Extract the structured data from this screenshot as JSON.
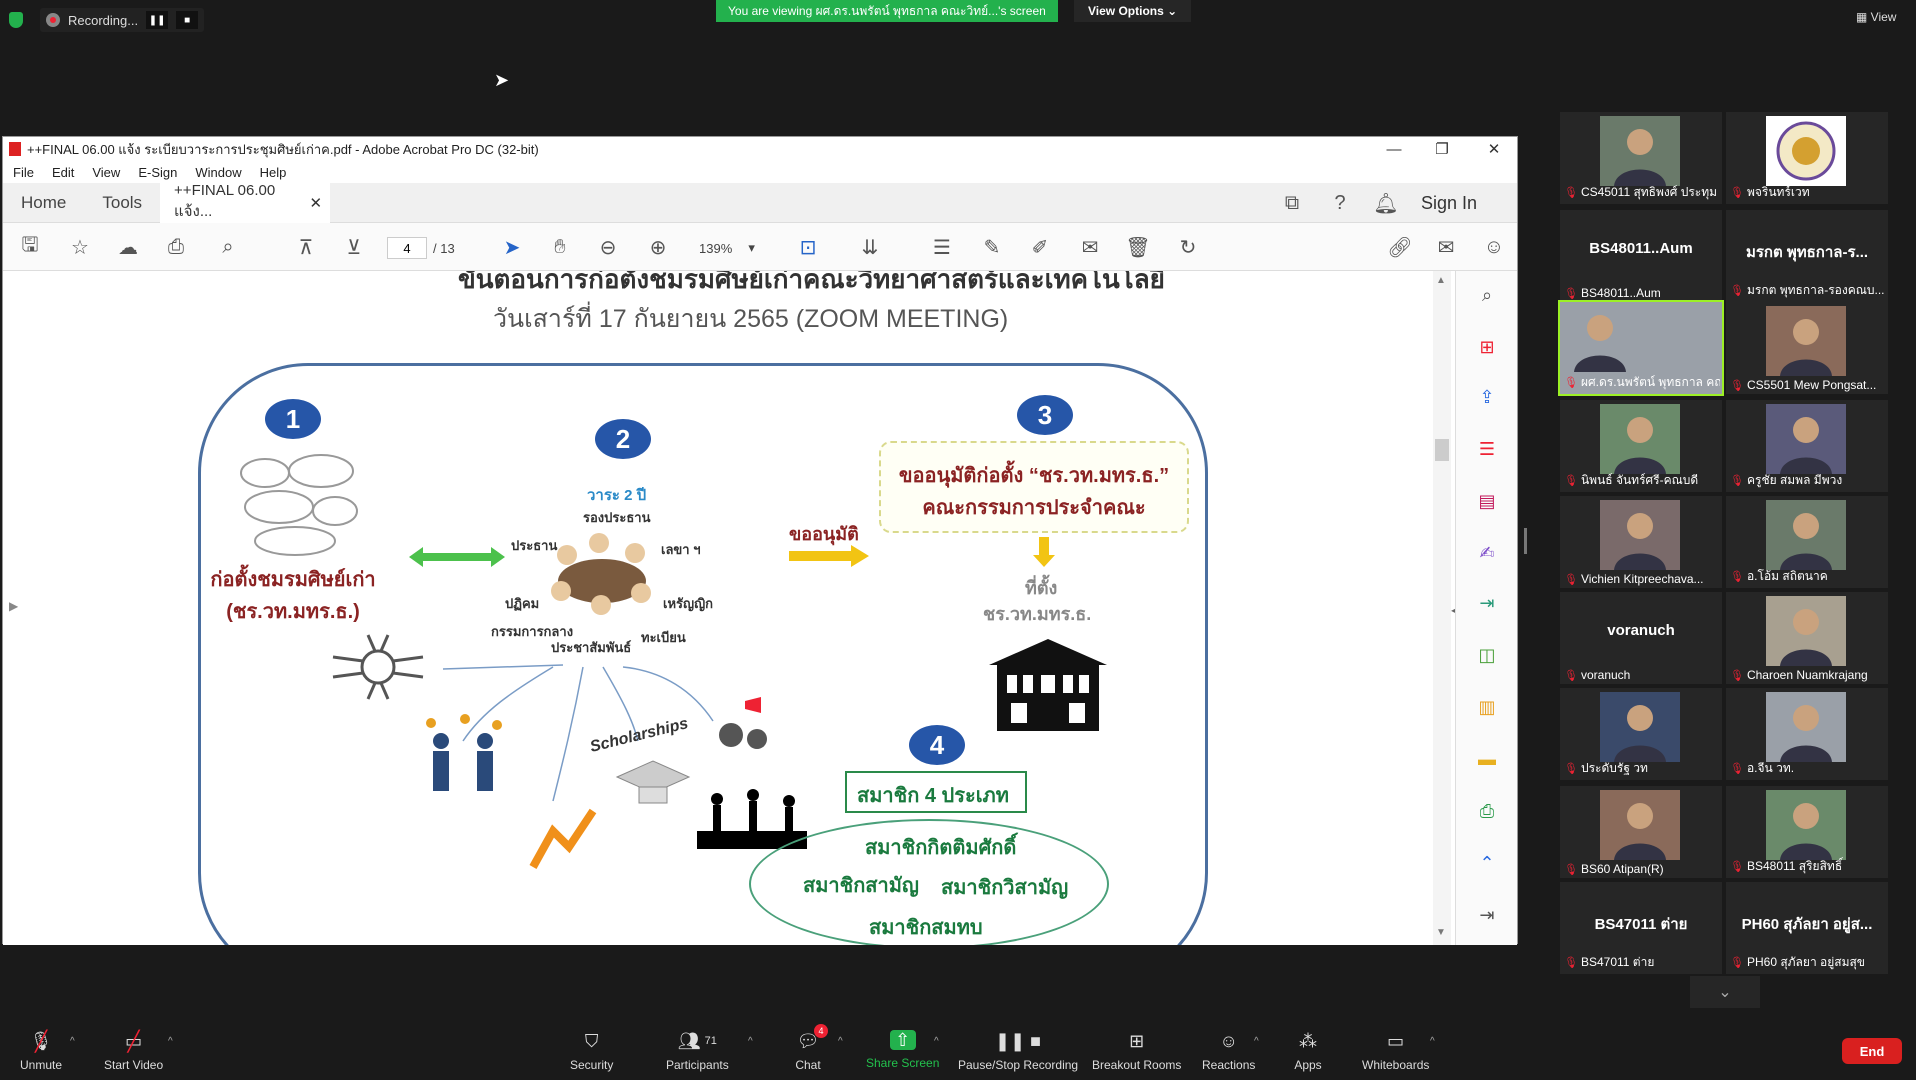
{
  "top": {
    "recording": "Recording...",
    "viewing_banner": "You are viewing ผศ.ดร.นพรัตน์ พุทธกาล คณะวิทย์...'s screen",
    "view_options": "View Options ⌄",
    "view_right": "View"
  },
  "acrobat": {
    "title": "++FINAL 06.00 แจ้ง ระเบียบวาระการประชุมศิษย์เก่าค.pdf - Adobe Acrobat Pro DC (32-bit)",
    "menu": [
      "File",
      "Edit",
      "View",
      "E-Sign",
      "Window",
      "Help"
    ],
    "tab_home": "Home",
    "tab_tools": "Tools",
    "tab_doc": "++FINAL 06.00 แจ้ง...",
    "sign_in": "Sign In",
    "page_current": "4",
    "page_total": "/ 13",
    "zoom": "139%"
  },
  "slide": {
    "title_partial": "ขั้นตอนการก่อตั้งชมรมศิษย์เก่าคณะวิทยาศาสตร์และเทคโนโลยี",
    "date_line": "วันเสาร์ที่ 17 กันยายน 2565 (ZOOM MEETING)",
    "n1": "1",
    "n2": "2",
    "n3": "3",
    "n4": "4",
    "step1": "ก่อตั้งชมรมศิษย์เก่า\n(ชร.วท.มทร.ธ.)",
    "term": "วาระ 2 ปี",
    "roles": {
      "vice": "รองประธาน",
      "chair": "ประธาน",
      "secretary": "เลขา ฯ",
      "reception": "ปฏิคม",
      "treasurer": "เหรัญญิก",
      "committee": "กรรมการกลาง",
      "registrar": "ทะเบียน",
      "pr": "ประชาสัมพันธ์"
    },
    "approve_label": "ขออนุมัติ",
    "step3_line1": "ขออนุมัติก่อตั้ง “ชร.วท.มทร.ธ.”",
    "step3_line2": "คณะกรรมการประจำคณะ",
    "location_label": "ที่ตั้ง",
    "location_name": "ชร.วท.มทร.ธ.",
    "scholarships": "Scholarships",
    "members_types": "สมาชิก 4 ประเภท",
    "member_honorary": "สมาชิกกิตติมศักดิ์",
    "member_ordinary": "สมาชิกสามัญ",
    "member_special": "สมาชิกวิสามัญ",
    "member_associate": "สมาชิกสมทบ"
  },
  "participants": [
    {
      "name": "CS45011 สุทธิพงศ์ ประทุม",
      "type": "photo"
    },
    {
      "name": "พจรินทร์เวท",
      "type": "logo"
    },
    {
      "name": "BS48011..Aum",
      "type": "text",
      "center": "BS48011..Aum"
    },
    {
      "name": "มรกต พุทธกาล-รองคณบ...",
      "type": "text",
      "center": "มรกต พุทธกาล-ร..."
    },
    {
      "name": "ผศ.ดร.นพรัตน์ พุทธกาล คณ...",
      "type": "photo",
      "active": true
    },
    {
      "name": "CS5501 Mew Pongsat...",
      "type": "photo"
    },
    {
      "name": "นิพนธ์ จันทร์ศรี-คณบดี",
      "type": "photo"
    },
    {
      "name": "ครูชัย สมพล มีพวง",
      "type": "photo"
    },
    {
      "name": "Vichien Kitpreechava...",
      "type": "photo"
    },
    {
      "name": "อ.โอ้ม สถิตนาค",
      "type": "photo"
    },
    {
      "name": "voranuch",
      "type": "text",
      "center": "voranuch"
    },
    {
      "name": "Charoen Nuamkrajang",
      "type": "photo"
    },
    {
      "name": "ประดับรัฐ วท",
      "type": "photo"
    },
    {
      "name": "อ.จีน วท.",
      "type": "photo"
    },
    {
      "name": "BS60 Atipan(R)",
      "type": "photo"
    },
    {
      "name": "BS48011 สุริยสิทธิ์",
      "type": "photo"
    },
    {
      "name": "BS47011 ต่าย",
      "type": "text",
      "center": "BS47011 ต่าย"
    },
    {
      "name": "PH60 สุภัลยา อยู่สมสุข",
      "type": "text",
      "center": "PH60 สุภัลยา อยู่ส..."
    }
  ],
  "bottom": {
    "unmute": "Unmute",
    "start_video": "Start Video",
    "security": "Security",
    "participants": "Participants",
    "participants_count": "71",
    "chat": "Chat",
    "chat_badge": "4",
    "share_screen": "Share Screen",
    "recording": "Pause/Stop Recording",
    "breakout": "Breakout Rooms",
    "reactions": "Reactions",
    "apps": "Apps",
    "whiteboards": "Whiteboards",
    "end": "End"
  }
}
